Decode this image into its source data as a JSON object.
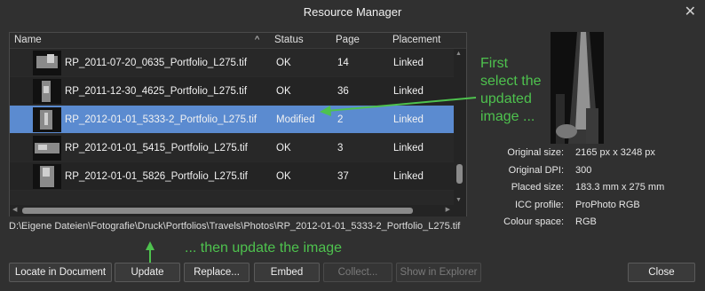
{
  "window": {
    "title": "Resource Manager",
    "close_glyph": "✕"
  },
  "list": {
    "columns": {
      "name": "Name",
      "status": "Status",
      "page": "Page",
      "placement": "Placement"
    },
    "sort_indicator": "^",
    "rows": [
      {
        "name": "RP_2011-07-20_0635_Portfolio_L275.tif",
        "status": "OK",
        "page": "14",
        "placement": "Linked"
      },
      {
        "name": "RP_2011-12-30_4625_Portfolio_L275.tif",
        "status": "OK",
        "page": "36",
        "placement": "Linked"
      },
      {
        "name": "RP_2012-01-01_5333-2_Portfolio_L275.tif",
        "status": "Modified",
        "page": "2",
        "placement": "Linked"
      },
      {
        "name": "RP_2012-01-01_5415_Portfolio_L275.tif",
        "status": "OK",
        "page": "3",
        "placement": "Linked"
      },
      {
        "name": "RP_2012-01-01_5826_Portfolio_L275.tif",
        "status": "OK",
        "page": "37",
        "placement": "Linked"
      }
    ]
  },
  "path": "D:\\Eigene Dateien\\Fotografie\\Druck\\Portfolios\\Travels\\Photos\\RP_2012-01-01_5333-2_Portfolio_L275.tif",
  "annotations": {
    "first": [
      "First",
      "select the",
      "updated",
      "image ..."
    ],
    "then": "... then update the image",
    "color": "#4ec24e"
  },
  "info": {
    "original_size": {
      "label": "Original size:",
      "value": "2165 px x 3248 px"
    },
    "original_dpi": {
      "label": "Original DPI:",
      "value": "300"
    },
    "placed_size": {
      "label": "Placed size:",
      "value": "183.3 mm x 275 mm"
    },
    "icc_profile": {
      "label": "ICC profile:",
      "value": "ProPhoto RGB"
    },
    "colour_space": {
      "label": "Colour space:",
      "value": "RGB"
    }
  },
  "buttons": {
    "locate": "Locate in Document",
    "update": "Update",
    "replace": "Replace...",
    "embed": "Embed",
    "collect": "Collect...",
    "show_explorer": "Show in Explorer",
    "close": "Close"
  },
  "colors": {
    "selection": "#5b8bd0",
    "background": "#303030"
  }
}
